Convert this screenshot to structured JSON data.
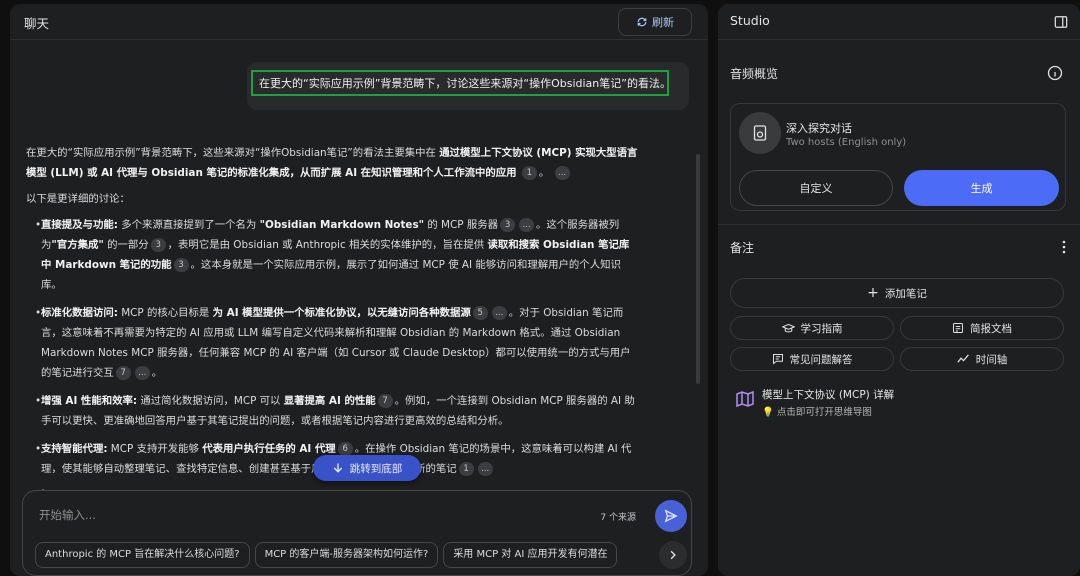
{
  "chat": {
    "title": "聊天",
    "refresh_label": "刷新",
    "query": "在更大的“实际应用示例”背景范畴下，讨论这些来源对“操作Obsidian笔记”的看法。",
    "answer": {
      "intro_a": "在更大的“实际应用示例”背景范畴下，这些来源对“操作Obsidian笔记”的看法主要集中在",
      "intro_b": "通过模型上下文协议 (MCP) 实现大型语言模型 (LLM) 或 AI 代理与 Obsidian 笔记的标准化集成，从而扩展 AI 在知识管理和个人工作流中的应用",
      "intro_cite": "1",
      "more": "...",
      "detail_heading": "以下是更详细的讨论：",
      "b1": {
        "title": "直接提及与功能:",
        "t1": " 多个来源直接提到了一个名为 ",
        "bold1": "\"Obsidian Markdown Notes\"",
        "t2": " 的 MCP 服务器",
        "cite1": "3",
        "t3": "。这个服务器被列为",
        "bold2": "\"官方集成\"",
        "t4": " 的一部分",
        "cite2": "3",
        "t5": "，表明它是由 Obsidian 或 Anthropic 相关的实体维护的，旨在提供 ",
        "bold3": "读取和搜索 Obsidian 笔记库中 Markdown 笔记的功能",
        "cite3": "3",
        "t6": "。这本身就是一个实际应用示例，展示了如何通过 MCP 使 AI 能够访问和理解用户的个人知识库。"
      },
      "b2": {
        "title": "标准化数据访问:",
        "t1": " MCP 的核心目标是 ",
        "bold1": "为 AI 模型提供一个标准化协议，以无缝访问各种数据源",
        "cite1": "5",
        "t2": "。对于 Obsidian 笔记而言，这意味着不再需要为特定的 AI 应用或 LLM 编写自定义代码来解析和理解 Obsidian 的 Markdown 格式。通过 Obsidian Markdown Notes MCP 服务器，任何兼容 MCP 的 AI 客户端（如 Cursor 或 Claude Desktop）都可以使用统一的方式与用户的笔记进行交互",
        "cite2": "7"
      },
      "b3": {
        "title": "增强 AI 性能和效率:",
        "t1": " 通过简化数据访问，MCP 可以 ",
        "bold1": "显著提高 AI 的性能",
        "cite1": "7",
        "t2": "。例如，一个连接到 Obsidian MCP 服务器的 AI 助手可以更快、更准确地回答用户基于其笔记提出的问题，或者根据笔记内容进行更高效的总结和分析。"
      },
      "b4": {
        "title": "支持智能代理:",
        "t1": " MCP 支持开发能够 ",
        "bold1": "代表用户执行任务的 AI 代理",
        "cite1": "6",
        "t2": "。在操作 Obsidian 笔记的场景中，这意味着可以构建 AI 代理，使其能够自动整理笔记、查找特定信息、创建",
        "t3": "甚至基于用户的指令修改或创建新的笔记",
        "cite2": "1",
        "t4": "。"
      }
    },
    "jump_label": "跳转到底部",
    "input_placeholder": "开始输入...",
    "sources_count": "7 个来源",
    "suggestions": [
      "Anthropic 的 MCP 旨在解决什么核心问题?",
      "MCP 的客户端-服务器架构如何运作?",
      "采用 MCP 对 AI 应用开发有何潜在"
    ]
  },
  "studio": {
    "title": "Studio",
    "audio_title": "音频概览",
    "audio_name": "深入探究对话",
    "audio_sub": "Two hosts (English only)",
    "customize_label": "自定义",
    "generate_label": "生成",
    "notes_title": "备注",
    "add_note_label": "添加笔记",
    "quick": [
      {
        "icon": "graduation-cap-icon",
        "label": "学习指南"
      },
      {
        "icon": "briefing-doc-icon",
        "label": "简报文档"
      },
      {
        "icon": "faq-icon",
        "label": "常见问题解答"
      },
      {
        "icon": "timeline-icon",
        "label": "时间轴"
      }
    ],
    "note_title": "模型上下文协议 (MCP) 详解",
    "note_sub": "💡 点击即可打开思维导图"
  },
  "colors": {
    "accent": "#4c6cf7",
    "query_border": "#1aa33b",
    "link": "#a8c7fa"
  }
}
